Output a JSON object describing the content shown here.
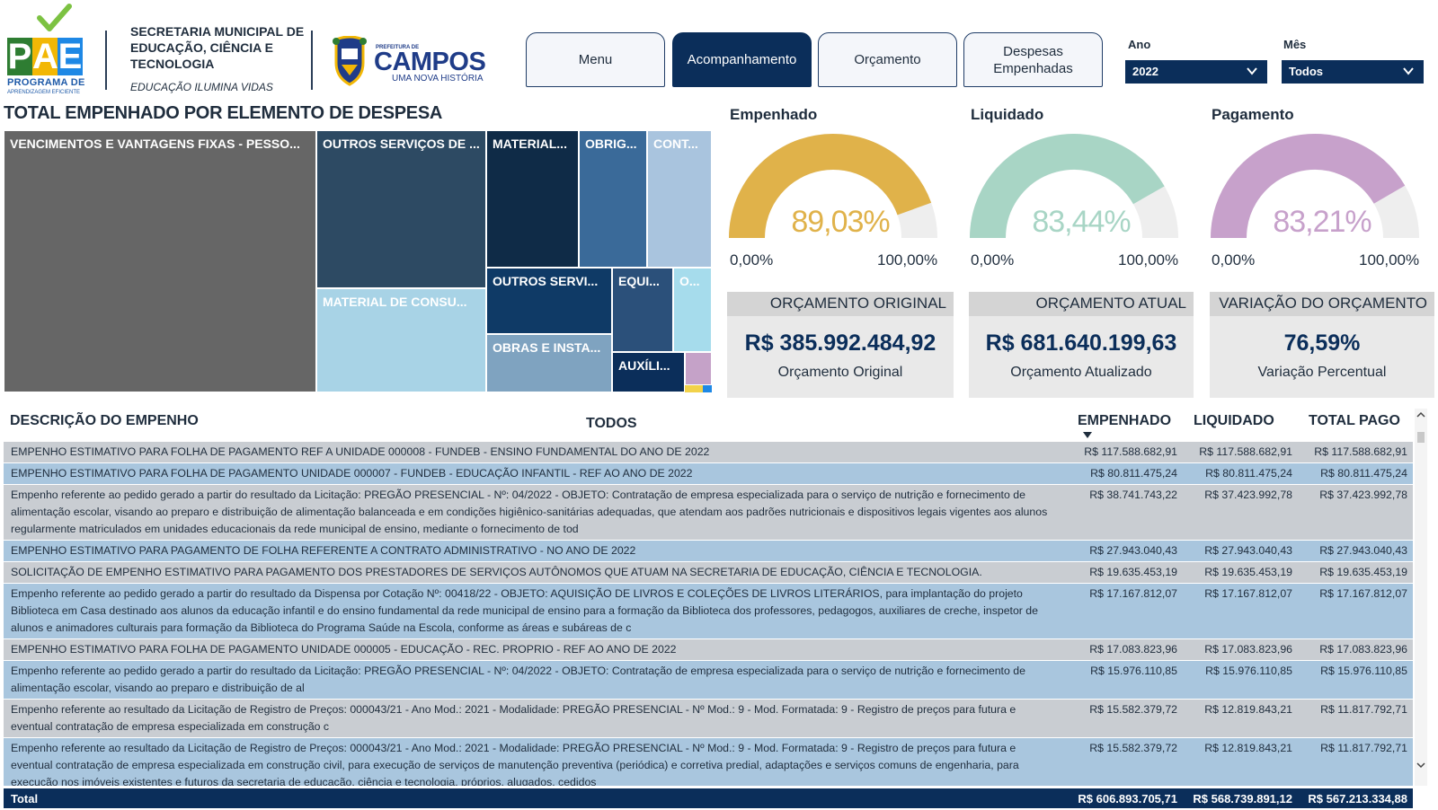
{
  "header": {
    "pae_letters": [
      "P",
      "A",
      "E"
    ],
    "pae_colors": [
      "#2e7d32",
      "#f2b705",
      "#1e88e5"
    ],
    "pae_subtitle": "PROGRAMA DE",
    "pae_subtitle2": "APRENDIZAGEM EFICIENTE",
    "secretaria": "SECRETARIA MUNICIPAL DE EDUCAÇÃO, CIÊNCIA E TECNOLOGIA",
    "slogan": "EDUCAÇÃO ILUMINA VIDAS",
    "campos_small": "PREFEITURA DE",
    "campos_name": "CAMPOS",
    "campos_tagline": "UMA NOVA HISTÓRIA"
  },
  "nav": {
    "menu": "Menu",
    "acompanhamento": "Acompanhamento",
    "orcamento": "Orçamento",
    "despesas": "Despesas Empenhadas",
    "active": "acompanhamento"
  },
  "filters": {
    "ano_label": "Ano",
    "ano_value": "2022",
    "mes_label": "Mês",
    "mes_value": "Todos"
  },
  "treemap": {
    "title": "TOTAL EMPENHADO POR ELEMENTO DE DESPESA",
    "cells": [
      {
        "label": "VENCIMENTOS E VANTAGENS FIXAS - PESSO...",
        "color": "#666666"
      },
      {
        "label": "OUTROS SERVIÇOS DE ...",
        "color": "#2d4a63"
      },
      {
        "label": "MATERIAL DE CONSU...",
        "color": "#a8d3e6"
      },
      {
        "label": "MATERIAL...",
        "color": "#0f2b47"
      },
      {
        "label": "OBRIG...",
        "color": "#3a6a99"
      },
      {
        "label": "CONT...",
        "color": "#a9c4de"
      },
      {
        "label": "OUTROS SERVI...",
        "color": "#0f3a66"
      },
      {
        "label": "EQUI...",
        "color": "#2b507a"
      },
      {
        "label": "O...",
        "color": "#a6dcec"
      },
      {
        "label": "OBRAS E INSTA...",
        "color": "#7fa3c0"
      },
      {
        "label": "AUXÍLI...",
        "color": "#0b2e5a"
      },
      {
        "label": "",
        "color": "#c5a2c8"
      }
    ]
  },
  "gauges": [
    {
      "title": "Empenhado",
      "value": "89,03%",
      "fraction": 0.8903,
      "color": "#e0b24a",
      "min": "0,00%",
      "max": "100,00%"
    },
    {
      "title": "Liquidado",
      "value": "83,44%",
      "fraction": 0.8344,
      "color": "#a8d5c5",
      "min": "0,00%",
      "max": "100,00%"
    },
    {
      "title": "Pagamento",
      "value": "83,21%",
      "fraction": 0.8321,
      "color": "#c7a1cb",
      "min": "0,00%",
      "max": "100,00%"
    }
  ],
  "cards": [
    {
      "head": "ORÇAMENTO ORIGINAL",
      "value": "R$ 385.992.484,92",
      "sub": "Orçamento Original"
    },
    {
      "head": "ORÇAMENTO ATUAL",
      "value": "R$ 681.640.199,63",
      "sub": "Orçamento Atualizado"
    },
    {
      "head": "VARIAÇÃO DO ORÇAMENTO",
      "value": "76,59%",
      "sub": "Variação Percentual"
    }
  ],
  "table": {
    "headers": {
      "descricao": "DESCRIÇÃO DO EMPENHO",
      "todos": "TODOS",
      "empenhado": "EMPENHADO",
      "liquidado": "LIQUIDADO",
      "pago": "TOTAL PAGO"
    },
    "rows": [
      {
        "desc": "EMPENHO ESTIMATIVO PARA FOLHA DE PAGAMENTO REF A UNIDADE 000008 - FUNDEB - ENSINO FUNDAMENTAL DO ANO DE 2022",
        "emp": "R$ 117.588.682,91",
        "liq": "R$ 117.588.682,91",
        "pag": "R$ 117.588.682,91"
      },
      {
        "desc": "EMPENHO ESTIMATIVO PARA FOLHA DE PAGAMENTO UNIDADE 000007 - FUNDEB - EDUCAÇÃO INFANTIL - REF AO ANO DE 2022",
        "emp": "R$ 80.811.475,24",
        "liq": "R$ 80.811.475,24",
        "pag": "R$ 80.811.475,24"
      },
      {
        "desc": "Empenho referente ao pedido gerado a partir do resultado da Licitação: PREGÃO PRESENCIAL - Nº: 04/2022 - OBJETO: Contratação de empresa especializada para o serviço de nutrição e fornecimento de alimentação escolar, visando ao preparo e distribuição de alimentação balanceada e em condições higiênico-sanitárias adequadas, que atendam aos padrões nutricionais e dispositivos legais vigentes aos alunos regularmente matriculados em unidades educacionais da rede municipal de ensino, mediante o fornecimento de tod",
        "emp": "R$ 38.741.743,22",
        "liq": "R$ 37.423.992,78",
        "pag": "R$ 37.423.992,78"
      },
      {
        "desc": "EMPENHO ESTIMATIVO PARA PAGAMENTO DE FOLHA REFERENTE A CONTRATO ADMINISTRATIVO - NO ANO DE 2022",
        "emp": "R$ 27.943.040,43",
        "liq": "R$ 27.943.040,43",
        "pag": "R$ 27.943.040,43"
      },
      {
        "desc": "SOLICITAÇÃO DE EMPENHO ESTIMATIVO PARA PAGAMENTO DOS PRESTADORES DE SERVIÇOS AUTÔNOMOS QUE ATUAM NA SECRETARIA DE EDUCAÇÃO, CIÊNCIA E TECNOLOGIA.",
        "emp": "R$ 19.635.453,19",
        "liq": "R$ 19.635.453,19",
        "pag": "R$ 19.635.453,19"
      },
      {
        "desc": "Empenho referente ao pedido gerado a partir do resultado da Dispensa por Cotação Nº: 00418/22 - OBJETO: AQUISIÇÃO DE LIVROS E COLEÇÕES DE LIVROS LITERÁRIOS, para implantação do projeto Biblioteca em Casa destinado aos alunos da educação infantil e do ensino fundamental da rede municipal de ensino para a formação da Biblioteca dos professores, pedagogos, auxiliares de creche, inspetor de alunos e animadores culturais para formação da Biblioteca do Programa Saúde na Escola, conforme as áreas e subáreas de c",
        "emp": "R$ 17.167.812,07",
        "liq": "R$ 17.167.812,07",
        "pag": "R$ 17.167.812,07"
      },
      {
        "desc": "EMPENHO ESTIMATIVO PARA FOLHA DE PAGAMENTO UNIDADE 000005 - EDUCAÇÃO - REC. PROPRIO - REF AO ANO DE 2022",
        "emp": "R$ 17.083.823,96",
        "liq": "R$ 17.083.823,96",
        "pag": "R$ 17.083.823,96"
      },
      {
        "desc": "Empenho referente ao pedido gerado a partir do resultado da Licitação: PREGÃO PRESENCIAL - Nº: 04/2022 - OBJETO: Contratação de empresa especializada para o serviço de nutrição e fornecimento de alimentação escolar, visando ao preparo e distribuição de al",
        "emp": "R$ 15.976.110,85",
        "liq": "R$ 15.976.110,85",
        "pag": "R$ 15.976.110,85"
      },
      {
        "desc": "Empenho referente ao resultado da Licitação de Registro de Preços: 000043/21 - Ano Mod.: 2021 - Modalidade: PREGÃO PRESENCIAL - Nº Mod.: 9 - Mod. Formatada: 9 - Registro de preços para futura e eventual contratação de empresa especializada em construção c",
        "emp": "R$ 15.582.379,72",
        "liq": "R$ 12.819.843,21",
        "pag": "R$ 11.817.792,71"
      },
      {
        "desc": "Empenho referente ao resultado da Licitação de Registro de Preços: 000043/21 - Ano Mod.: 2021 - Modalidade: PREGÃO PRESENCIAL - Nº Mod.: 9 - Mod. Formatada: 9 - Registro de preços para futura e eventual contratação de empresa especializada em construção civil, para execução de serviços de manutenção preventiva (periódica) e corretiva predial, adaptações e serviços comuns de engenharia, para execução nos imóveis existentes e futuros da secretaria de educação, ciência e tecnologia, próprios, alugados, cedidos",
        "emp": "R$ 15.582.379,72",
        "liq": "R$ 12.819.843,21",
        "pag": "R$ 11.817.792,71"
      }
    ],
    "total": {
      "label": "Total",
      "emp": "R$ 606.893.705,71",
      "liq": "R$ 568.739.891,12",
      "pag": "R$ 567.213.334,88"
    }
  }
}
